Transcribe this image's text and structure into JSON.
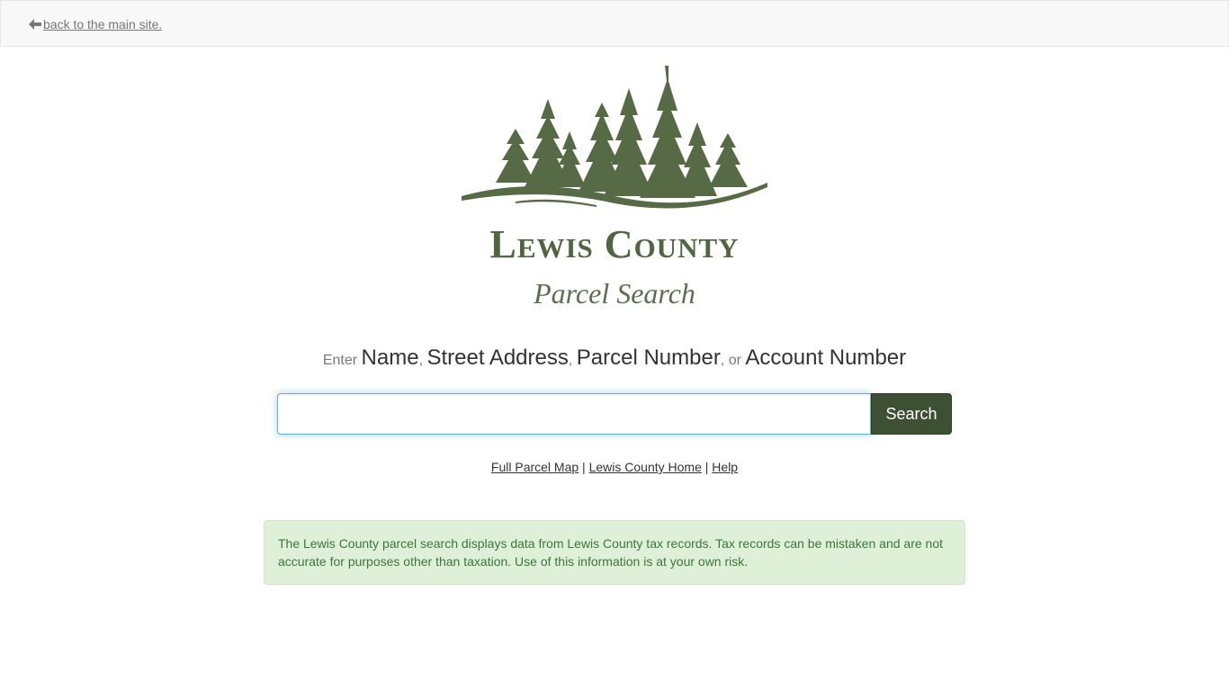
{
  "nav": {
    "back_label": " back to the main site."
  },
  "logo": {
    "title": "Lewis County",
    "subtitle": "Parcel Search"
  },
  "prompt": {
    "enter": "Enter ",
    "name": "Name",
    "comma1": ", ",
    "street": "Street Address",
    "comma2": ", ",
    "parcel": "Parcel Number",
    "or": ", or ",
    "account": "Account Number"
  },
  "search": {
    "value": "",
    "button_label": "Search"
  },
  "links": {
    "full_map": "Full Parcel Map",
    "sep1": " | ",
    "home": "Lewis County Home",
    "sep2": " | ",
    "help": "Help"
  },
  "notice": {
    "text": "The Lewis County parcel search displays data from Lewis County tax records. Tax records can be mistaken and are not accurate for purposes other than taxation. Use of this information is at your own risk."
  },
  "colors": {
    "brand_green": "#4f6640",
    "button_green": "#3d5033",
    "notice_bg": "#dff0d8",
    "notice_text": "#3c763d"
  }
}
